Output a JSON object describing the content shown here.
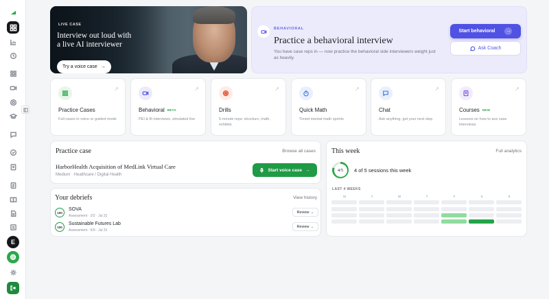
{
  "sidebar": {
    "avatar_initial": "E",
    "icons": [
      "logo-icon",
      "dashboard-icon",
      "analytics-icon",
      "history-icon",
      "grid-icon",
      "video-icon",
      "target-icon",
      "graduation-icon",
      "chat-icon",
      "clock-icon",
      "clipboard-icon",
      "document-icon",
      "book-icon",
      "file-icon",
      "list-icon"
    ]
  },
  "hero": {
    "badge": "LIVE CASE",
    "title": "Interview out loud with a live AI interviewer",
    "button": "Try a voice case",
    "arrow": "→"
  },
  "behavioral_card": {
    "eyebrow": "BEHAVIORAL",
    "title": "Practice a behavioral interview",
    "description": "You have case reps in — now practice the behavioral side interviewers weight just as heavily.",
    "start_label": "Start behavioral",
    "coach_label": "Ask Coach",
    "arrow": "→"
  },
  "features": [
    {
      "name": "Practice Cases",
      "badge": "",
      "sub": "Full cases in voice or guided mode",
      "color": "#2aa84a",
      "bg": "#e7f5ea",
      "icon": "grid-icon"
    },
    {
      "name": "Behavioral",
      "badge": "BETA",
      "sub": "PEI & fit interviews, simulated live",
      "color": "#4f52e3",
      "bg": "#ecebfb",
      "icon": "video-icon"
    },
    {
      "name": "Drills",
      "badge": "",
      "sub": "5-minute reps: structure, math, exhibits",
      "color": "#e0533a",
      "bg": "#fdece6",
      "icon": "target-icon"
    },
    {
      "name": "Quick Math",
      "badge": "",
      "sub": "Timed mental-math sprints",
      "color": "#4a7be0",
      "bg": "#e8f0fc",
      "icon": "stopwatch-icon"
    },
    {
      "name": "Chat",
      "badge": "",
      "sub": "Ask anything, get your next step",
      "color": "#4a7be0",
      "bg": "#e8f0fc",
      "icon": "chat-icon"
    },
    {
      "name": "Courses",
      "badge": "NEW",
      "sub": "Lessons on how to ace case interviews",
      "color": "#7a4fe0",
      "bg": "#f1ebfc",
      "icon": "book-icon"
    }
  ],
  "practice_case": {
    "title": "Practice case",
    "browse_link": "Browse all cases",
    "case_name": "HarborHealth Acquisition of MedLink Virtual Care",
    "case_meta": "Medium · Healthcare / Digital Health",
    "start_label": "Start voice case",
    "arrow": "→"
  },
  "debriefs": {
    "title": "Your debriefs",
    "history_link": "View history",
    "items": [
      {
        "score": "100",
        "name": "SOVA",
        "meta": "Assessment · 2/2 · Jul 31",
        "review": "Review →"
      },
      {
        "score": "100",
        "name": "Sustainable Futures Lab",
        "meta": "Assessment · 6/9 · Jul 31",
        "review": "Review →"
      }
    ]
  },
  "this_week": {
    "title": "This week",
    "analytics_link": "Full analytics",
    "ring_label": "4/5",
    "sessions_done": 4,
    "sessions_goal": 5,
    "sessions_text": "4 of 5 sessions this week",
    "weeks_label": "LAST 4 WEEKS",
    "days": [
      "M",
      "T",
      "W",
      "T",
      "F",
      "S",
      "S"
    ],
    "activity_levels": [
      [
        0,
        0,
        0,
        0,
        0,
        0,
        0
      ],
      [
        0,
        0,
        0,
        0,
        0,
        0,
        0
      ],
      [
        0,
        0,
        0,
        0,
        1,
        0,
        0
      ],
      [
        0,
        0,
        0,
        0,
        1,
        2,
        0
      ]
    ],
    "colors": {
      "empty": "#eceef1",
      "light": "#8fdc9f",
      "strong": "#23a347"
    }
  }
}
